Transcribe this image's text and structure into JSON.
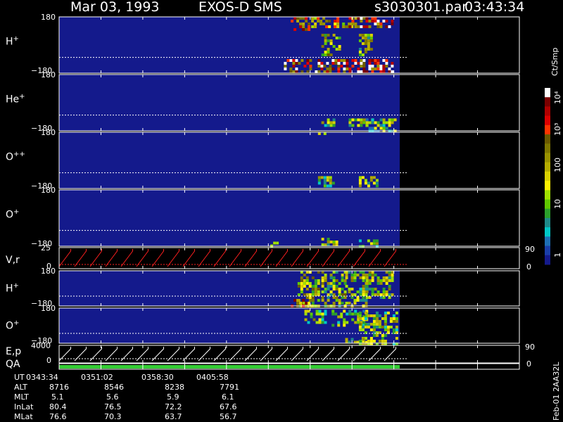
{
  "header": {
    "date": "Mar 03, 1993",
    "instrument": "EXOS-D SMS",
    "file": "s3030301.par",
    "time": "03:43:34"
  },
  "colorbar": {
    "unit_label": "Ct/Smp",
    "tick_labels": [
      "10⁴",
      "10³",
      "100",
      "10",
      "1"
    ],
    "colors": [
      "#ffffff",
      "#7a0000",
      "#b00000",
      "#dd0000",
      "#ff3300",
      "#6b5a00",
      "#7f7700",
      "#999200",
      "#b5ac00",
      "#d8d000",
      "#fff000",
      "#a0e000",
      "#60c800",
      "#2ca02c",
      "#1f8a8a",
      "#00c8c8",
      "#1e6fb5",
      "#1a3ea8",
      "#141a8c"
    ]
  },
  "panels": [
    {
      "species": "H",
      "sup": "+",
      "top_tick": "180",
      "bottom_tick": "−180"
    },
    {
      "species": "He",
      "sup": "+",
      "top_tick": "180",
      "bottom_tick": "−180"
    },
    {
      "species": "O",
      "sup": "++",
      "top_tick": "180",
      "bottom_tick": "−180"
    },
    {
      "species": "O",
      "sup": "+",
      "top_tick": "180",
      "bottom_tick": "−180"
    },
    {
      "species": "V,r",
      "sup": "",
      "top_tick": "25",
      "bottom_tick": "0",
      "right_top": "90",
      "right_bottom": "0"
    },
    {
      "species": "H",
      "sup": "+",
      "top_tick": "180",
      "bottom_tick": "−180"
    },
    {
      "species": "O",
      "sup": "+",
      "top_tick": "180",
      "bottom_tick": "−180"
    },
    {
      "species": "E,p",
      "sup": "",
      "top_tick": "4000",
      "bottom_tick": "0",
      "right_top": "90",
      "right_bottom": "0"
    },
    {
      "species": "QA",
      "sup": "",
      "top_tick": "",
      "bottom_tick": "",
      "right_top": "",
      "right_bottom": ""
    }
  ],
  "chart_data": {
    "type": "heatmap",
    "time_ticks": [
      "0343:34",
      "0351:02",
      "0358:30",
      "0405:58"
    ],
    "data_fraction_of_span": 0.74,
    "ylim_angle": [
      -180,
      180
    ]
  },
  "footer": {
    "rows": [
      {
        "label": "UT",
        "values": [
          "0343:34",
          "0351:02",
          "0358:30",
          "0405:58"
        ]
      },
      {
        "label": "ALT",
        "values": [
          "8716",
          "8546",
          "8238",
          "7791"
        ]
      },
      {
        "label": "MLT",
        "values": [
          "5.1",
          "5.6",
          "5.9",
          "6.1"
        ]
      },
      {
        "label": "InLat",
        "values": [
          "80.4",
          "76.5",
          "72.2",
          "67.6"
        ]
      },
      {
        "label": "MLat",
        "values": [
          "76.6",
          "70.3",
          "63.7",
          "56.7"
        ]
      }
    ],
    "stamp": "Feb-01 2AA32L"
  }
}
